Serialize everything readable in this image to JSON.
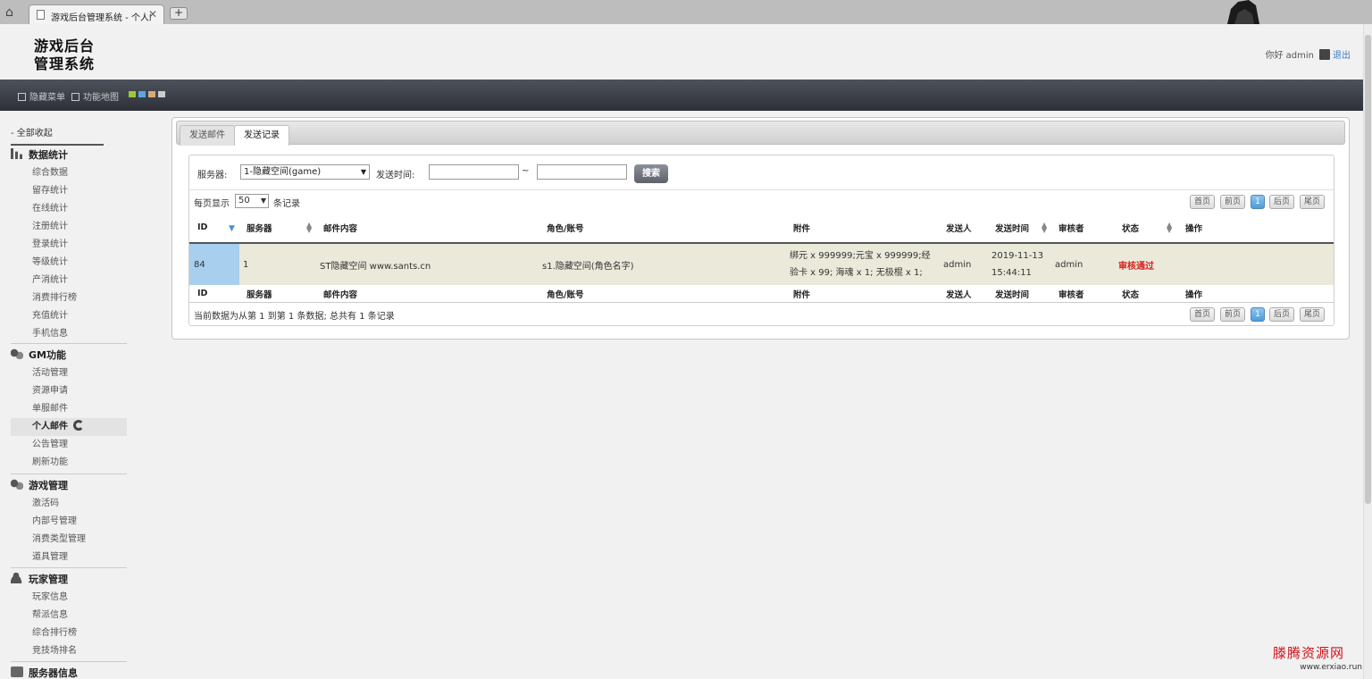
{
  "browser": {
    "tab_title": "游戏后台管理系统 - 个人邮件",
    "new_tab_label": "+",
    "close_label": "✕"
  },
  "header": {
    "logo_line1": "游戏后台",
    "logo_line2": "管理系统",
    "greeting": "你好 admin",
    "logout": "退出"
  },
  "toolbar": {
    "hide_menu": "隐藏菜单",
    "function_map": "功能地图",
    "swatch_colors": [
      "#9bc93a",
      "#5ba6e0",
      "#d7a87a",
      "#cccccc"
    ]
  },
  "sidebar": {
    "collapse_all": "- 全部收起",
    "sections": [
      {
        "title": "数据统计",
        "icon": "bar-chart-icon",
        "items": [
          "综合数据",
          "留存统计",
          "在线统计",
          "注册统计",
          "登录统计",
          "等级统计",
          "产消统计",
          "消费排行榜",
          "充值统计",
          "手机信息"
        ]
      },
      {
        "title": "GM功能",
        "icon": "gears-icon",
        "items": [
          "活动管理",
          "资源申请",
          "单服邮件",
          "个人邮件",
          "公告管理",
          "刷新功能"
        ],
        "active": "个人邮件"
      },
      {
        "title": "游戏管理",
        "icon": "gears-icon",
        "items": [
          "激活码",
          "内部号管理",
          "消费类型管理",
          "道具管理"
        ]
      },
      {
        "title": "玩家管理",
        "icon": "user-icon",
        "items": [
          "玩家信息",
          "帮派信息",
          "综合排行榜",
          "竞技场排名"
        ]
      },
      {
        "title": "服务器信息",
        "icon": "server-icon",
        "items": []
      }
    ]
  },
  "main": {
    "tabs": [
      {
        "label": "发送邮件",
        "active": false
      },
      {
        "label": "发送记录",
        "active": true
      }
    ],
    "filter": {
      "server_label": "服务器:",
      "server_value": "1-隐藏空间(game)",
      "time_label": "发送时间:",
      "range_sep": "~",
      "time_from": "",
      "time_to": "",
      "search": "搜索"
    },
    "page_size": {
      "before": "每页显示",
      "value": "50",
      "after": "条记录"
    },
    "pager": [
      "首页",
      "前页",
      "1",
      "后页",
      "尾页"
    ],
    "columns": [
      "ID",
      "服务器",
      "邮件内容",
      "角色/账号",
      "附件",
      "发送人",
      "发送时间",
      "审核者",
      "状态",
      "操作"
    ],
    "rows": [
      {
        "id": "84",
        "server": "1",
        "content": "ST隐藏空间 www.sants.cn",
        "role": "s1.隐藏空间(角色名字)",
        "attachment": "绑元 x 999999;元宝 x 999999;经验卡 x 99; 海魂 x 1; 无极棍 x 1;",
        "sender": "admin",
        "send_time": "2019-11-13 15:44:11",
        "reviewer": "admin",
        "status": "审核通过",
        "action": ""
      }
    ],
    "summary": "当前数据为从第 1 到第 1 条数据; 总共有 1 条记录"
  },
  "watermark": {
    "title": "滕腾资源网",
    "url": "www.erxiao.run"
  }
}
